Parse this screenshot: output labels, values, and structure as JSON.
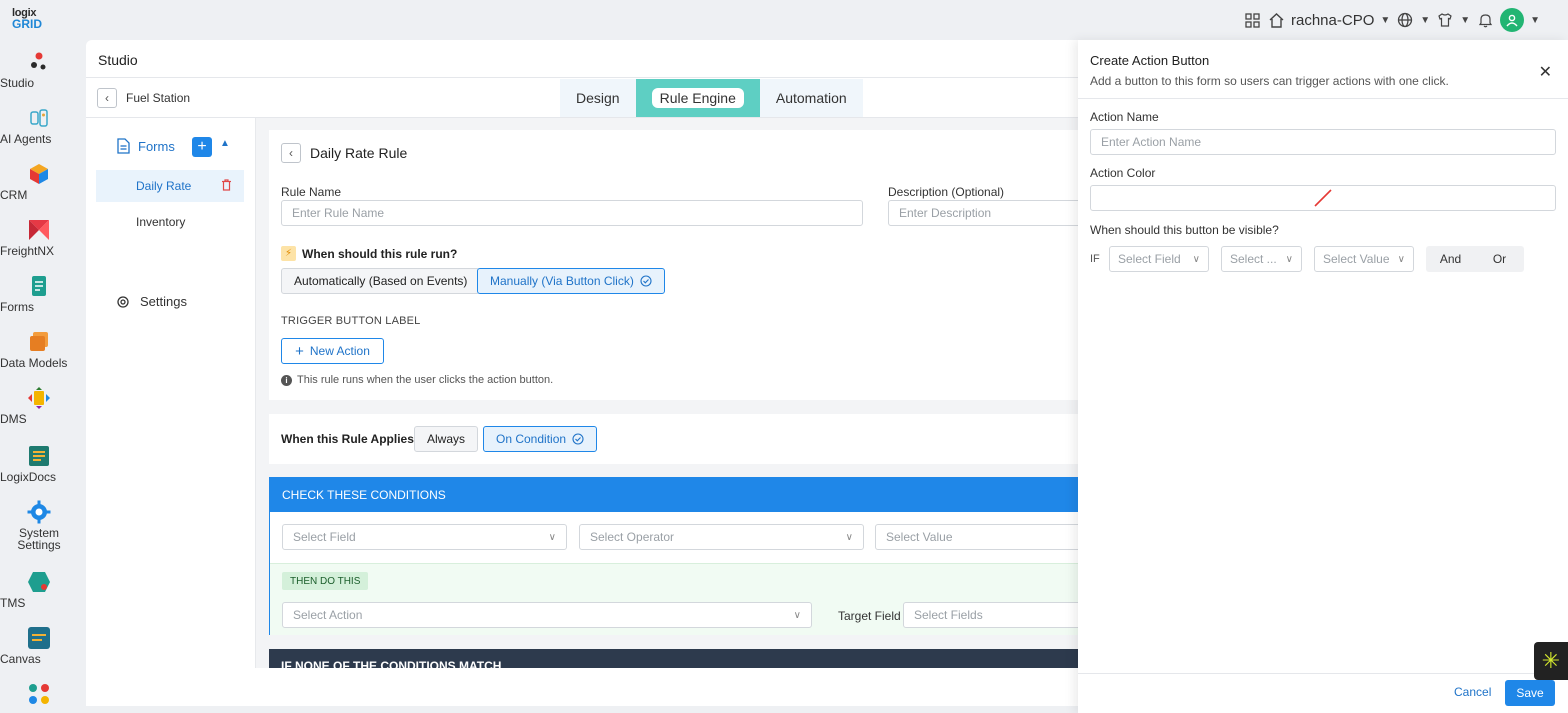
{
  "brand": {
    "logo_top": "logix",
    "logo_bottom": "GRID"
  },
  "topbar": {
    "workspace": "rachna-CPO"
  },
  "nav": [
    {
      "label": "Studio",
      "icon": "studio-icon"
    },
    {
      "label": "AI Agents",
      "icon": "ai-agents-icon"
    },
    {
      "label": "CRM",
      "icon": "crm-icon"
    },
    {
      "label": "FreightNX",
      "icon": "freightnx-icon"
    },
    {
      "label": "Forms",
      "icon": "forms-icon"
    },
    {
      "label": "Data Models",
      "icon": "data-models-icon"
    },
    {
      "label": "DMS",
      "icon": "dms-icon"
    },
    {
      "label": "LogixDocs",
      "icon": "logixdocs-icon"
    },
    {
      "label": "System Settings",
      "icon": "system-settings-icon"
    },
    {
      "label": "TMS",
      "icon": "tms-icon"
    },
    {
      "label": "Canvas",
      "icon": "canvas-icon"
    }
  ],
  "studio": {
    "title": "Studio",
    "form_name": "Fuel Station"
  },
  "tabs": [
    "Design",
    "Rule Engine",
    "Automation"
  ],
  "sidebar": {
    "forms_label": "Forms",
    "items": [
      "Daily Rate",
      "Inventory"
    ],
    "settings_label": "Settings"
  },
  "rule": {
    "title": "Daily Rate Rule",
    "name_label": "Rule Name",
    "name_placeholder": "Enter Rule Name",
    "desc_label": "Description (Optional)",
    "desc_placeholder": "Enter Description",
    "run_question": "When should this rule run?",
    "opt_auto": "Automatically (Based on Events)",
    "opt_manual": "Manually (Via Button Click)",
    "trigger_label": "TRIGGER BUTTON LABEL",
    "new_action": "New Action",
    "info": "This rule runs when the user clicks the action button."
  },
  "applies": {
    "label": "When this Rule Applies",
    "always": "Always",
    "on_condition": "On Condition"
  },
  "conditions": {
    "header": "CHECK THESE CONDITIONS",
    "field_ph": "Select Field",
    "operator_ph": "Select Operator",
    "value_ph": "Select Value",
    "then_label": "THEN DO THIS",
    "action_ph": "Select Action",
    "target_label": "Target Field",
    "fields_ph": "Select Fields",
    "none_header": "IF NONE OF THE CONDITIONS MATCH"
  },
  "drawer": {
    "title": "Create Action Button",
    "subtitle": "Add a button to this form so users can trigger actions with one click.",
    "action_name_label": "Action Name",
    "action_name_ph": "Enter Action Name",
    "action_color_label": "Action Color",
    "visible_label": "When should this button be visible?",
    "if_label": "IF",
    "field_ph": "Select Field",
    "op_ph": "Select ...",
    "value_ph": "Select Value",
    "and": "And",
    "or": "Or",
    "cancel": "Cancel",
    "save": "Save"
  },
  "colors": {
    "accent": "#1f87e8",
    "tab_active": "#5ecfc3",
    "dark_header": "#2d3a4d"
  }
}
